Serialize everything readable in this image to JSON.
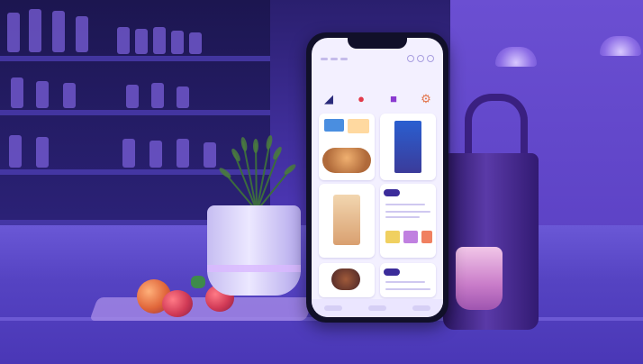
{
  "scene": {
    "colors": {
      "tint": "#4a35b0",
      "phone_screen": "#f3f0ff",
      "accent": "#5b4cb0"
    }
  },
  "phone": {
    "category_icons": [
      "shoe-icon",
      "location-pin-icon",
      "bag-icon",
      "settings-icon"
    ]
  }
}
